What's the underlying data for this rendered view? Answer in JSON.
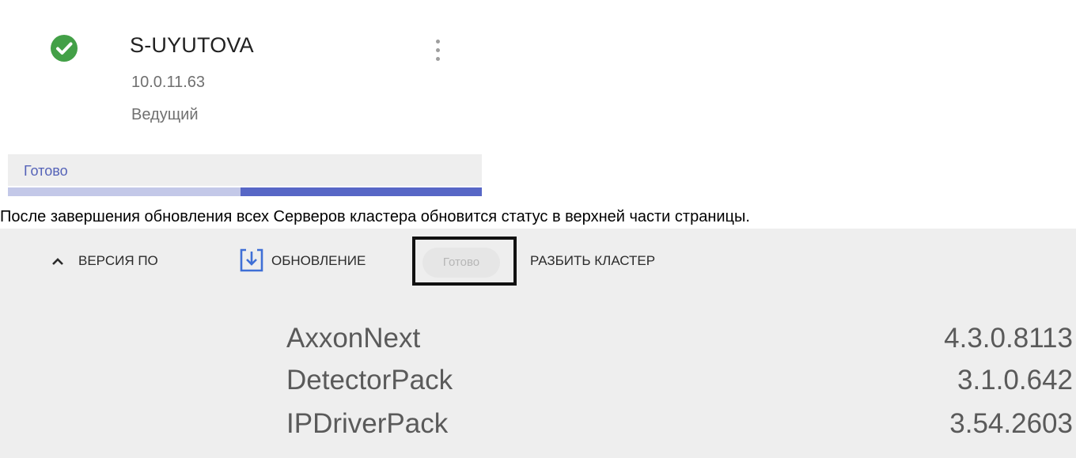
{
  "server": {
    "name": "S-UYUTOVA",
    "ip": "10.0.11.63",
    "role": "Ведущий",
    "status": "Готово",
    "progress": 0.51,
    "accent_color": "#5767c6",
    "status_color": "#43a047",
    "icons": [
      "check-circle-icon",
      "more-vert-icon"
    ]
  },
  "caption": "После завершения обновления всех Серверов кластера обновится статус в верхней части страницы.",
  "toolbar": {
    "version_label": "ВЕРСИЯ ПО",
    "update_label": "ОБНОВЛЕНИЕ",
    "ready_label": "Готово",
    "split_label": "РАЗБИТЬ КЛАСТЕР",
    "icons": [
      "chevron-up-icon",
      "download-icon"
    ]
  },
  "packages": [
    {
      "name": "AxxonNext",
      "version": "4.3.0.8113"
    },
    {
      "name": "DetectorPack",
      "version": "3.1.0.642"
    },
    {
      "name": "IPDriverPack",
      "version": "3.54.2603"
    }
  ]
}
